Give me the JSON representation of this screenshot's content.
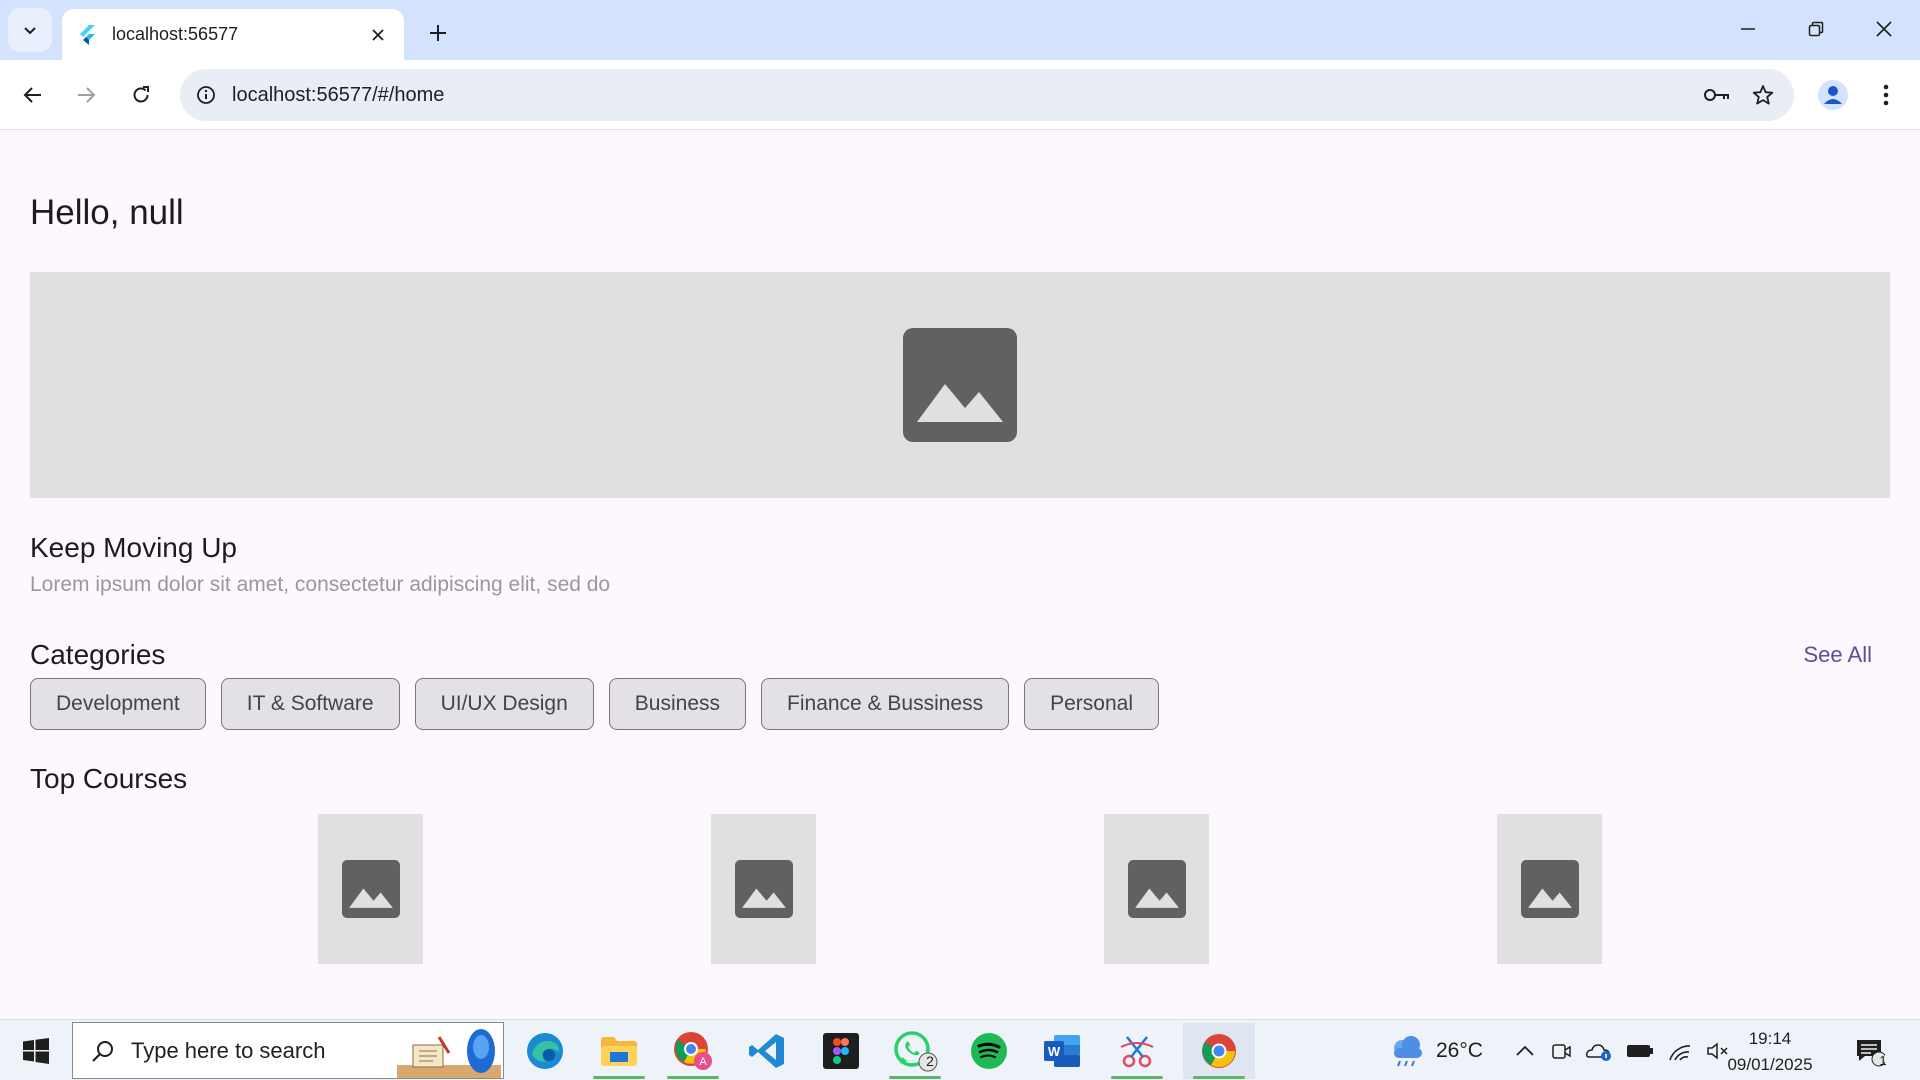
{
  "browser": {
    "tab_title": "localhost:56577",
    "url": "localhost:56577/#/home",
    "icons": [
      "tab-search-icon",
      "flutter-favicon",
      "close-icon",
      "plus-icon",
      "minimize-icon",
      "restore-icon",
      "close-window-icon",
      "back-icon",
      "forward-icon",
      "reload-icon",
      "info-icon",
      "key-icon",
      "star-icon",
      "profile-icon",
      "kebab-menu-icon"
    ]
  },
  "page": {
    "greeting": "Hello, null",
    "banner_icon": "image-placeholder-icon",
    "promo_title": "Keep Moving Up",
    "promo_subtitle": "Lorem ipsum dolor sit amet, consectetur adipiscing elit, sed do",
    "categories_title": "Categories",
    "see_all": "See All",
    "categories": [
      "Development",
      "IT & Software",
      "UI/UX Design",
      "Business",
      "Finance & Bussiness",
      "Personal"
    ],
    "top_courses_title": "Top Courses",
    "course_thumbnail_count": 4
  },
  "taskbar": {
    "search_placeholder": "Type here to search",
    "apps": [
      "edge",
      "file-explorer",
      "chrome-profile",
      "vscode",
      "figma",
      "whatsapp",
      "spotify",
      "word",
      "snipping-tool",
      "chrome"
    ],
    "whatsapp_badge": "2",
    "temperature": "26°C",
    "time": "19:14",
    "date": "09/01/2025",
    "notification_count": "1"
  },
  "colors": {
    "tabstrip": "#d3e3fd",
    "page_bg": "#fdf7fe",
    "placeholder_bg": "#e0e0e0",
    "placeholder_icon": "#616161",
    "link": "#5b4f9a"
  }
}
